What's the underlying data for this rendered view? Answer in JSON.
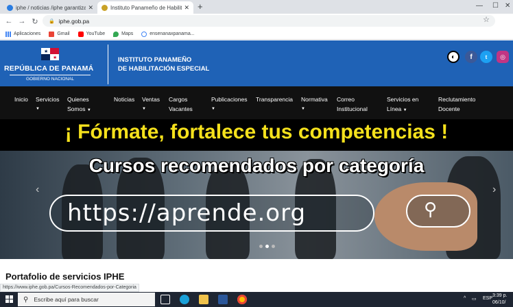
{
  "browser": {
    "tabs": [
      {
        "title": "iphe / noticias /iphe garantiza e",
        "active": false
      },
      {
        "title": "Instituto Panameño de Habilitació",
        "active": true
      }
    ],
    "address": "iphe.gob.pa",
    "bookmarks": [
      "Aplicaciones",
      "Gmail",
      "YouTube",
      "Maps",
      "ensenanaxpanama..."
    ],
    "status_url": "https://www.iphe.gob.pa/Cursos-Recomendados-por-Categoria"
  },
  "header": {
    "republic": "REPÚBLICA DE PANAMÁ",
    "government": "GOBIERNO NACIONAL",
    "institute_line1": "INSTITUTO PANAMEÑO",
    "institute_line2": "DE HABILITACIÓN ESPECIAL",
    "social": [
      "accessibility-icon",
      "facebook-icon",
      "twitter-icon",
      "instagram-icon"
    ],
    "brand_color": "#1f62b6"
  },
  "nav": {
    "items": [
      {
        "line1": "Inicio",
        "line2": "",
        "caret": false
      },
      {
        "line1": "Servicios",
        "line2": "",
        "caret": true
      },
      {
        "line1": "Quienes",
        "line2": "Somos",
        "caret": true
      },
      {
        "line1": "Noticias",
        "line2": "",
        "caret": false
      },
      {
        "line1": "Ventas",
        "line2": "",
        "caret": true
      },
      {
        "line1": "Cargos",
        "line2": "Vacantes",
        "caret": false
      },
      {
        "line1": "Publicaciones",
        "line2": "",
        "caret": true
      },
      {
        "line1": "Transparencia",
        "line2": "",
        "caret": false
      },
      {
        "line1": "Normativa",
        "line2": "",
        "caret": true
      },
      {
        "line1": "Correo",
        "line2": "Institucional",
        "caret": false
      },
      {
        "line1": "Servicios en",
        "line2": "Línea",
        "caret": true
      },
      {
        "line1": "Reclutamiento",
        "line2": "Docente",
        "caret": false
      }
    ]
  },
  "hero": {
    "headline": "¡ Fórmate, fortalece tus competencias !",
    "subtitle": "Cursos recomendados por categoría",
    "url": "https://aprende.org",
    "headline_color": "#f5e11c"
  },
  "main": {
    "section_title": "Portafolio de servicios IPHE"
  },
  "taskbar": {
    "search_placeholder": "Escribe aquí para buscar",
    "language": "ESP",
    "time": "3:39 p.",
    "date": "06/10/"
  }
}
